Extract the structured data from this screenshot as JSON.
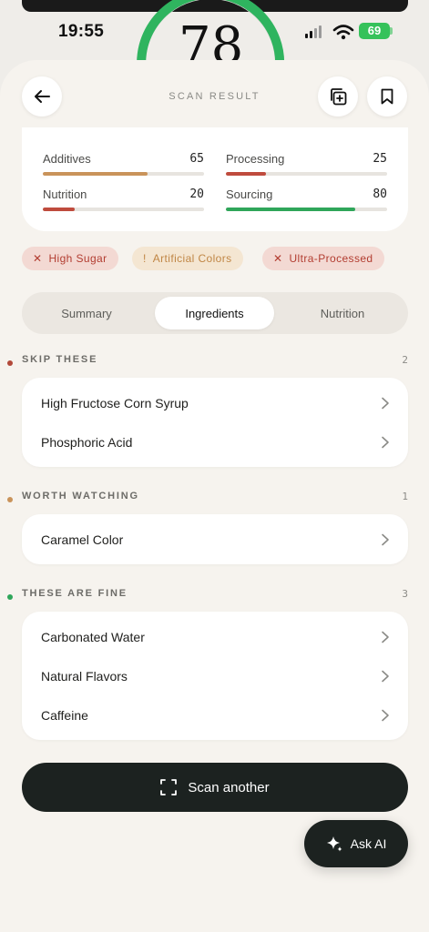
{
  "status_bar": {
    "time": "19:55",
    "battery": "69"
  },
  "score": {
    "value": "78",
    "ring_fraction": 0.78
  },
  "header": {
    "title": "SCAN RESULT"
  },
  "metrics": [
    {
      "label": "Additives",
      "value": "65",
      "fraction": 0.65,
      "color": "#c9935a"
    },
    {
      "label": "Processing",
      "value": "25",
      "fraction": 0.25,
      "color": "#bf4b3d"
    },
    {
      "label": "Nutrition",
      "value": "20",
      "fraction": 0.2,
      "color": "#bf4b3d"
    },
    {
      "label": "Sourcing",
      "value": "80",
      "fraction": 0.8,
      "color": "#2fa65a"
    }
  ],
  "tags": [
    {
      "glyph": "✕",
      "label": "High Sugar"
    },
    {
      "glyph": "!",
      "label": "Artificial Colors"
    },
    {
      "glyph": "✕",
      "label": "Ultra-Processed"
    }
  ],
  "tabs": [
    {
      "label": "Summary",
      "active": false
    },
    {
      "label": "Ingredients",
      "active": true
    },
    {
      "label": "Nutrition",
      "active": false
    }
  ],
  "sections": [
    {
      "title": "SKIP THESE",
      "count": "2",
      "dot_color": "#b2493a",
      "items": [
        "High Fructose Corn Syrup",
        "Phosphoric Acid"
      ]
    },
    {
      "title": "WORTH WATCHING",
      "count": "1",
      "dot_color": "#c9935a",
      "items": [
        "Caramel Color"
      ]
    },
    {
      "title": "THESE ARE FINE",
      "count": "3",
      "dot_color": "#2fa65a",
      "items": [
        "Carbonated Water",
        "Natural Flavors",
        "Caffeine"
      ]
    }
  ],
  "actions": {
    "scan_another": "Scan another",
    "ask_ai": "Ask AI"
  },
  "colors": {
    "accent_dark": "#1c2220",
    "good": "#2fa65a",
    "warn": "#c9935a",
    "bad": "#bf4b3d"
  }
}
